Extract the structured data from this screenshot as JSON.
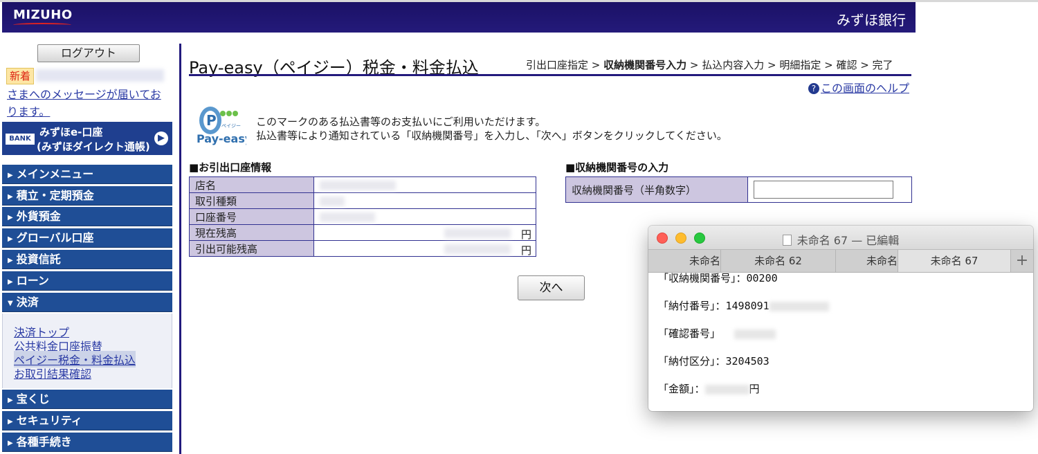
{
  "header": {
    "logo": "MIZUHO",
    "brand": "みずほ銀行"
  },
  "sidebar": {
    "logout": "ログアウト",
    "new_badge": "新着",
    "message": "さまへのメッセージが届いております。",
    "e_account": {
      "bank_tag": "BANK",
      "line1": "みずほe-口座",
      "line2": "(みずほダイレクト通帳)"
    },
    "menu": [
      "メインメニュー",
      "積立・定期預金",
      "外貨預金",
      "グローバル口座",
      "投資信託",
      "ローン",
      "決済",
      "宝くじ",
      "セキュリティ",
      "各種手続き"
    ],
    "submenu": [
      "決済トップ",
      "公共料金口座振替",
      "ペイジー税金・料金払込",
      "お取引結果確認"
    ]
  },
  "main": {
    "title": "Pay-easy（ペイジー）税金・料金払込",
    "steps": {
      "s1": "引出口座指定 > ",
      "current": "収納機関番号入力",
      "rest": " > 払込内容入力 > 明細指定 > 確認 > 完了"
    },
    "help": "この画面のヘルプ",
    "payeasy_logo_text": "Pay-easy",
    "payeasy_logo_sub": "ペイジー",
    "intro1": "このマークのある払込書等のお支払いにご利用いただけます。",
    "intro2": "払込書等により通知されている「収納機関番号」を入力し、「次へ」ボタンをクリックしてください。",
    "account_section": "■お引出口座情報",
    "account_rows": [
      {
        "label": "店名",
        "unit": ""
      },
      {
        "label": "取引種類",
        "unit": ""
      },
      {
        "label": "口座番号",
        "unit": ""
      },
      {
        "label": "現在残高",
        "unit": "円"
      },
      {
        "label": "引出可能残高",
        "unit": "円"
      }
    ],
    "input_section": "■収納機関番号の入力",
    "input_label": "収納機関番号（半角数字）",
    "input_value": "",
    "next_button": "次へ"
  },
  "textedit": {
    "title": "未命名 67 — 已編輯",
    "tabs": [
      "未命名",
      "未命名 62",
      "未命名",
      "未命名 67"
    ],
    "lines": [
      "「収納機関番号」：00200",
      "「納付番号」：1498091",
      "「確認番号」",
      "「納付区分」：3204503",
      "「金額」："
    ],
    "yen": "円"
  },
  "colors": {
    "header": "#1b1166",
    "nav": "#1f4e96",
    "label_bg": "#cdc6e0",
    "link": "#2a3aa4"
  }
}
